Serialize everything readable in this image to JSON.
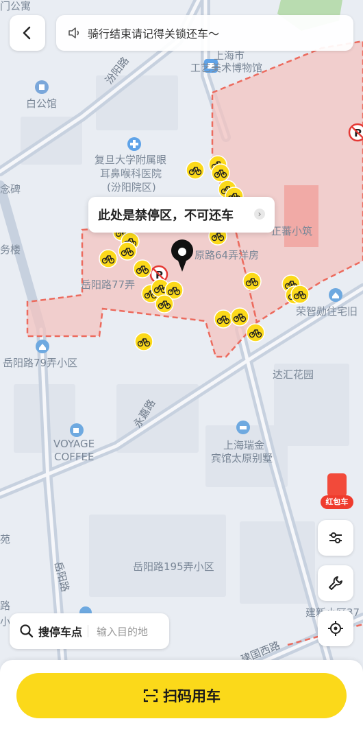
{
  "header": {
    "notice_text": "骑行结束请记得关锁还车～"
  },
  "map": {
    "labels": [
      {
        "id": "label-top-left-gongyu",
        "text": "门公寓"
      },
      {
        "id": "label-gongyi-1",
        "text": "上海市"
      },
      {
        "id": "label-gongyi-2",
        "text": "工艺美术博物馆"
      },
      {
        "id": "label-baigongguan",
        "text": "白公馆"
      },
      {
        "id": "label-hospital-1",
        "text": "复旦大学附属眼"
      },
      {
        "id": "label-hospital-2",
        "text": "耳鼻喉科医院"
      },
      {
        "id": "label-hospital-3",
        "text": "(汾阳院区)"
      },
      {
        "id": "label-jinianbei",
        "text": "念碑"
      },
      {
        "id": "label-wulou",
        "text": "务楼"
      },
      {
        "id": "label-zhengfan",
        "text": "正蕃小筑"
      },
      {
        "id": "label-fenyang64",
        "text": "原路64弄洋房"
      },
      {
        "id": "label-yueyang77",
        "text": "岳阳路77弄"
      },
      {
        "id": "label-rongzhi",
        "text": "荣智勋住宅旧"
      },
      {
        "id": "label-yueyang79",
        "text": "岳阳路79弄小区"
      },
      {
        "id": "label-dahui",
        "text": "达汇花园"
      },
      {
        "id": "label-voyage-1",
        "text": "VOYAGE"
      },
      {
        "id": "label-voyage-2",
        "text": "COFFEE"
      },
      {
        "id": "label-ruijin-1",
        "text": "上海瑞金"
      },
      {
        "id": "label-ruijin-2",
        "text": "宾馆太原别墅"
      },
      {
        "id": "label-yueyang195",
        "text": "岳阳路195弄小区"
      },
      {
        "id": "label-yuan",
        "text": "苑"
      },
      {
        "id": "label-jianxin",
        "text": "建新小区37"
      },
      {
        "id": "label-lu-left",
        "text": "路"
      },
      {
        "id": "label-xiao-left",
        "text": "小"
      }
    ],
    "roads": [
      {
        "id": "road-fenyang",
        "text": "汾阳路"
      },
      {
        "id": "road-yongjia",
        "text": "永嘉路"
      },
      {
        "id": "road-yueyang",
        "text": "岳阳路"
      },
      {
        "id": "road-jianguo",
        "text": "建国西路"
      }
    ]
  },
  "tooltip": {
    "text": "此处是禁停区，不可还车"
  },
  "side": {
    "redpacket_label": "红包车"
  },
  "search": {
    "label": "搜停车点",
    "placeholder": "输入目的地"
  },
  "bottom": {
    "scan_label": "扫码用车"
  },
  "colors": {
    "accent_yellow": "#fbd91a",
    "no_park_zone": "#f2b6b3",
    "no_park_border": "#ec6b5e",
    "map_bg": "#e9edf3",
    "road": "#c9d3e0",
    "red_packet": "#ef3b2d"
  },
  "icons": {
    "back": "chevron-left-icon",
    "notice": "speaker-icon",
    "pin": "location-pin-icon",
    "filter": "sliders-icon",
    "wrench": "wrench-icon",
    "locate": "crosshair-icon",
    "search": "search-icon",
    "scan": "scan-icon",
    "bike": "bike-icon",
    "no_parking": "no-parking-icon"
  }
}
